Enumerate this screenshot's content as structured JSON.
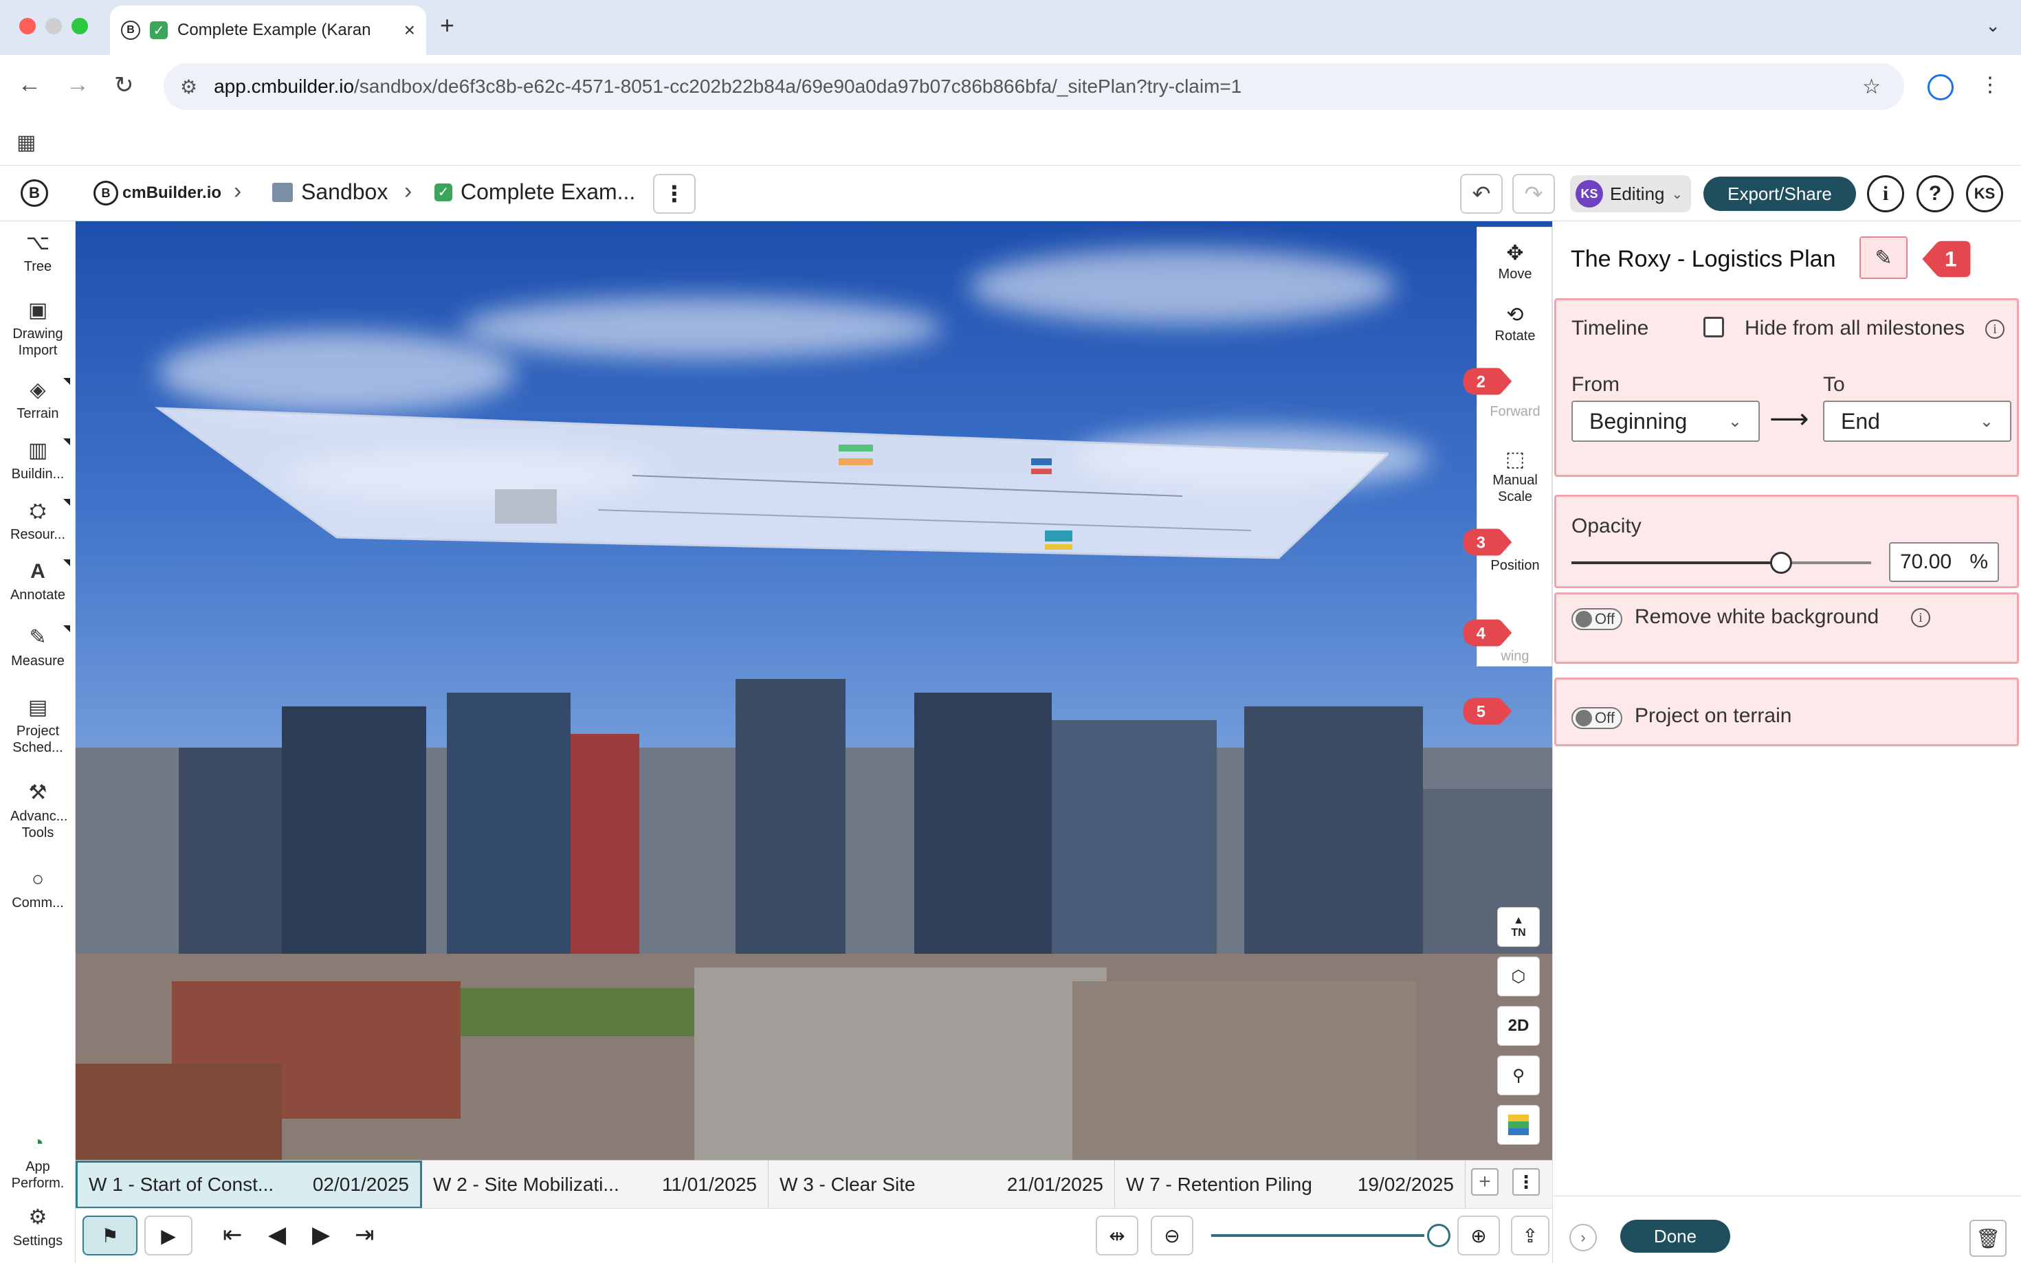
{
  "browser": {
    "tab_title": "Complete Example (Karan",
    "url_host": "app.cmbuilder.io",
    "url_path": "/sandbox/de6f3c8b-e62c-4571-8051-cc202b22b84a/69e90a0da97b07c86b866bfa/_sitePlan?try-claim=1"
  },
  "header": {
    "brand": "cmBuilder.io",
    "crumb_sandbox": "Sandbox",
    "crumb_project": "Complete Exam...",
    "editing_initials": "KS",
    "editing_label": "Editing",
    "export_label": "Export/Share",
    "user_initials": "KS"
  },
  "sidebar": {
    "items": [
      {
        "label": "Tree"
      },
      {
        "label": "Drawing Import"
      },
      {
        "label": "Terrain"
      },
      {
        "label": "Buildin..."
      },
      {
        "label": "Resour..."
      },
      {
        "label": "Annotate"
      },
      {
        "label": "Measure"
      },
      {
        "label": "Project Sched..."
      },
      {
        "label": "Advanc... Tools"
      },
      {
        "label": "Comm..."
      },
      {
        "label": "App Perform."
      },
      {
        "label": "Settings"
      }
    ]
  },
  "viewport_tools": {
    "move": "Move",
    "rotate": "Rotate",
    "forward": "Forward",
    "manual_scale": "Manual Scale",
    "position": "Position",
    "drawing": "wing",
    "north": "TN",
    "mode_2d": "2D"
  },
  "milestones": [
    {
      "name": "W 1 - Start of Const...",
      "date": "02/01/2025",
      "active": true
    },
    {
      "name": "W 2 - Site Mobilizati...",
      "date": "11/01/2025",
      "active": false
    },
    {
      "name": "W 3 - Clear Site",
      "date": "21/01/2025",
      "active": false
    },
    {
      "name": "W 7 - Retention Piling",
      "date": "19/02/2025",
      "active": false
    }
  ],
  "zoom_level": 0.76,
  "panel": {
    "title": "The Roxy - Logistics Plan",
    "timeline_label": "Timeline",
    "hide_label": "Hide from all milestones",
    "hide_checked": false,
    "from_label": "From",
    "from_value": "Beginning",
    "to_label": "To",
    "to_value": "End",
    "opacity_label": "Opacity",
    "opacity_value": "70.00",
    "opacity_unit": "%",
    "opacity_fraction": 0.7,
    "remove_bg_label": "Remove white background",
    "remove_bg_state": "Off",
    "project_label": "Project on terrain",
    "project_state": "Off",
    "done_label": "Done"
  },
  "callouts": [
    "1",
    "2",
    "3",
    "4",
    "5"
  ],
  "colors": {
    "accent": "#1f4e5f",
    "callout_red": "#e5474f",
    "highlight_fill": "#fde8ea",
    "highlight_border": "#f2a3ac"
  }
}
